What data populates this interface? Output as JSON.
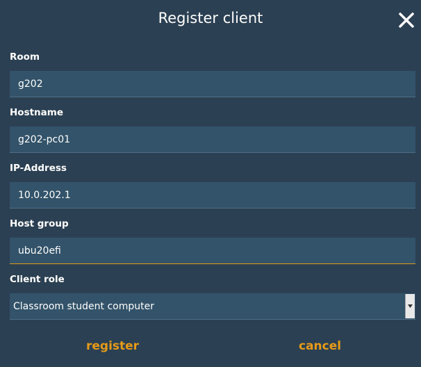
{
  "dialog": {
    "title": "Register client",
    "close_icon": "close-icon"
  },
  "fields": {
    "room": {
      "label": "Room",
      "value": "g202"
    },
    "hostname": {
      "label": "Hostname",
      "value": "g202-pc01"
    },
    "ip_address": {
      "label": "IP-Address",
      "value": "10.0.202.1"
    },
    "host_group": {
      "label": "Host group",
      "value": "ubu20efi"
    },
    "client_role": {
      "label": "Client role",
      "value": "Classroom student computer"
    }
  },
  "actions": {
    "register_label": "register",
    "cancel_label": "cancel"
  },
  "colors": {
    "background": "#2b4052",
    "input_background": "#32536a",
    "accent": "#e59a18"
  }
}
